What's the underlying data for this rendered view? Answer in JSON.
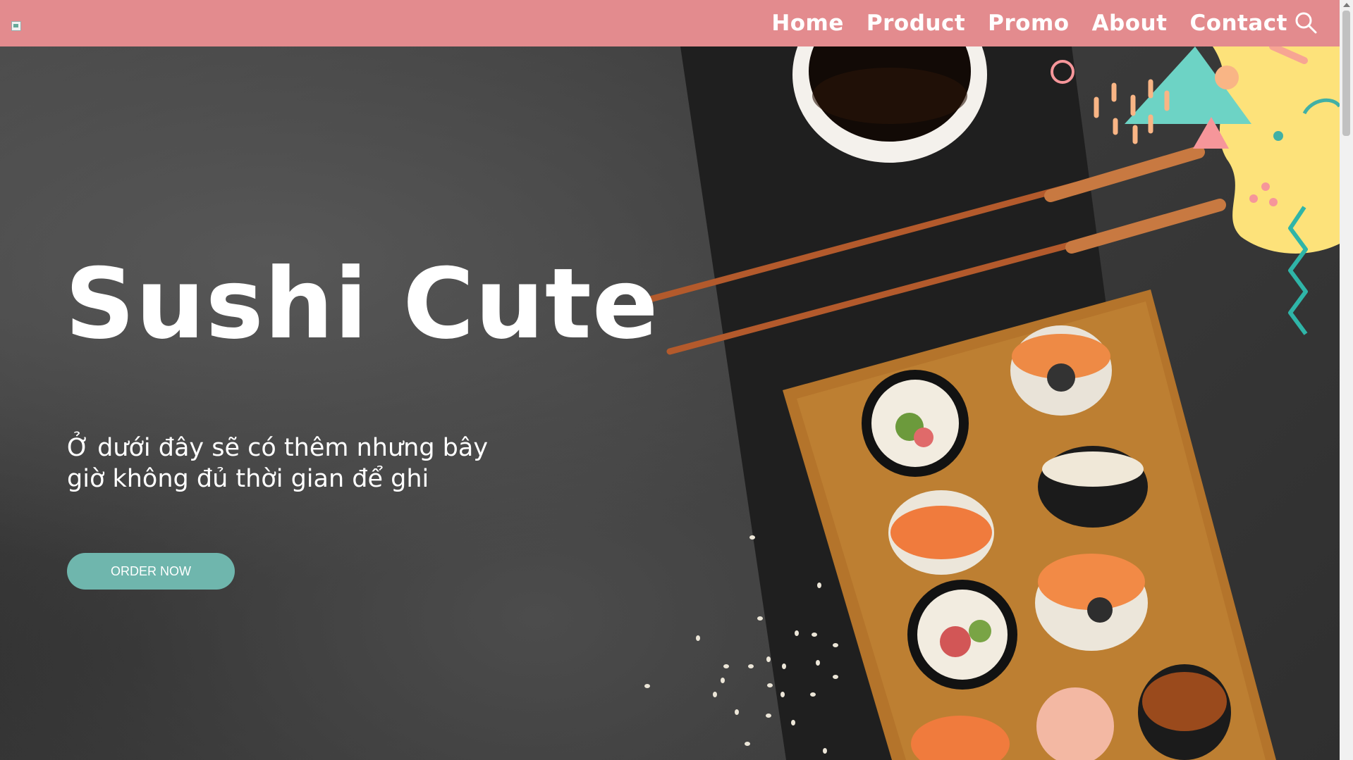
{
  "nav": {
    "items": [
      "Home",
      "Product",
      "Promo",
      "About",
      "Contact"
    ],
    "search_icon": "search-icon"
  },
  "hero": {
    "title": "Sushi Cute",
    "subtitle": "Ở dưới đây sẽ có thêm nhưng bây giờ không đủ thời gian để ghi",
    "cta_label": "ORDER NOW"
  },
  "colors": {
    "nav_bg": "#e38b8e",
    "cta_bg": "#6fb6ad",
    "text": "#ffffff"
  }
}
